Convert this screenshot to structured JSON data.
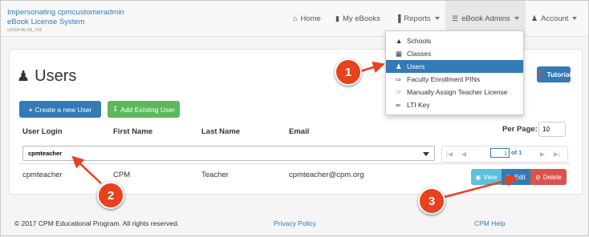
{
  "header": {
    "brand_line1": "Impersonating cpmcustomeradmin",
    "brand_line2": "eBook License System",
    "version": "v2018-06-28_718"
  },
  "nav": {
    "home": "Home",
    "my_ebooks": "My eBooks",
    "reports": "Reports",
    "ebook_admins": "eBook Admins",
    "account": "Account"
  },
  "dropdown": {
    "items": [
      {
        "label": "Schools",
        "icon": "graduation-cap-icon"
      },
      {
        "label": "Classes",
        "icon": "calendar-icon"
      },
      {
        "label": "Users",
        "icon": "user-icon",
        "selected": true
      },
      {
        "label": "Faculty Enrollment PINs",
        "icon": "sign-in-icon"
      },
      {
        "label": "Manually Assign Teacher License",
        "icon": "hand-point-icon"
      },
      {
        "label": "LTI Key",
        "icon": "link-icon"
      }
    ]
  },
  "page": {
    "title": "Users",
    "create_button": "Create a new User",
    "add_existing_button": "Add Existing User",
    "tutorial_button": "Tutorial"
  },
  "table": {
    "columns": [
      "User Login",
      "First Name",
      "Last Name",
      "Email"
    ],
    "per_page_label": "Per Page:",
    "per_page_value": "10",
    "filter_value": "cpmteacher",
    "pager": {
      "page": "1",
      "of": "of 1"
    },
    "rows": [
      {
        "login": "cpmteacher",
        "first": "CPM",
        "last": "Teacher",
        "email": "cpmteacher@cpm.org"
      }
    ],
    "actions": {
      "view": "View",
      "edit": "Edit",
      "delete": "Delete"
    }
  },
  "footer": {
    "copyright": "© 2017 CPM Educational Program. All rights reserved.",
    "privacy": "Privacy Policy",
    "help": "CPM Help"
  },
  "callouts": [
    "1",
    "2",
    "3"
  ],
  "colors": {
    "primary": "#337ab7",
    "success": "#5cb85c",
    "info": "#5bc0de",
    "danger": "#d9534f",
    "callout": "#e8411e"
  }
}
